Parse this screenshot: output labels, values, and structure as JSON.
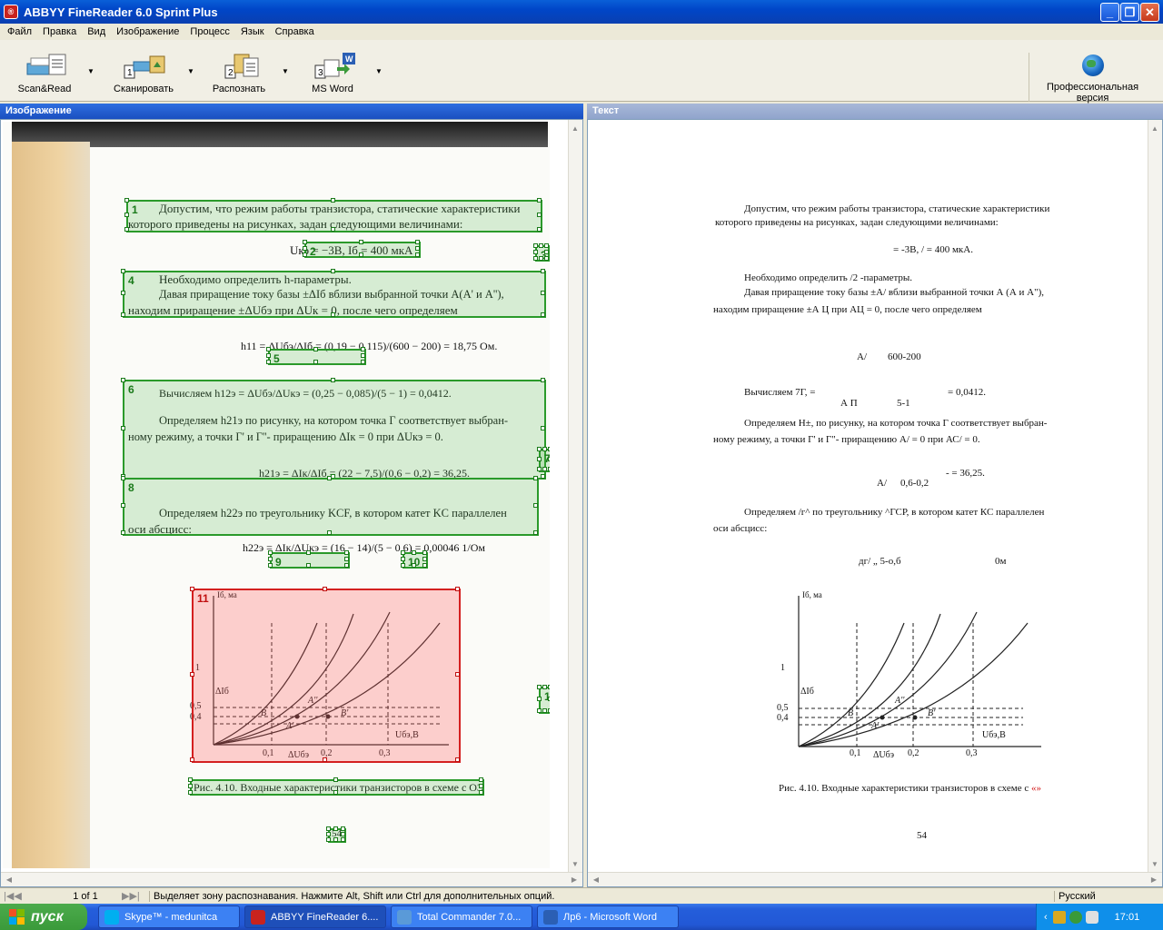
{
  "window": {
    "title": "ABBYY FineReader 6.0 Sprint Plus"
  },
  "menu": [
    "Файл",
    "Правка",
    "Вид",
    "Изображение",
    "Процесс",
    "Язык",
    "Справка"
  ],
  "toolbar": {
    "buttons": [
      {
        "label": "Scan&Read",
        "icon": "scan-read-icon"
      },
      {
        "label": "Сканировать",
        "icon": "scan-icon",
        "step": "1"
      },
      {
        "label": "Распознать",
        "icon": "recognize-icon",
        "step": "2"
      },
      {
        "label": "MS Word",
        "icon": "word-export-icon",
        "step": "3"
      }
    ],
    "pro_label": "Профессиональная версия"
  },
  "panes": {
    "image_title": "Изображение",
    "text_title": "Текст"
  },
  "scan": {
    "p1a": "Допустим, что режим работы транзистора, статические характеристики",
    "p1b": "которого приведены на рисунках, задан следующими величинами:",
    "eq1": "Uкэ = −3В, Iб = 400 мкА .",
    "p2a": "Необходимо определить h-параметры.",
    "p2b": "Давая приращение току базы ±ΔIб вблизи выбранной точки A(A' и A''),",
    "p2c": "находим приращение ±ΔUбэ при ΔUк = 0, после чего определяем",
    "eq2a": "h11 = ΔUбэ/ΔIб = (0,19 − 0,115)/(600 − 200) = 18,75 Ом.",
    "p3a": "Вычисляем h12э = ΔUбэ/ΔUкэ = (0,25 − 0,085)/(5 − 1) = 0,0412.",
    "p3b": "Определяем h21э по рисунку, на котором точка Г соответствует выбран-",
    "p3c": "ному режиму, а точки Г' и Г''- приращению ΔIк = 0 при ΔUкэ = 0.",
    "eq3": "h21э = ΔIк/ΔIб = (22 − 7,5)/(0,6 − 0,2) = 36,25.",
    "p4a": "Определяем h22э по треугольнику KCF, в котором катет KC параллелен",
    "p4b": "оси абсцисс:",
    "eq4": "h22э = ΔIк/ΔUкэ = (16 − 14)/(5 − 0,6) = 0,00046 1/Ом",
    "caption": "Рис. 4.10. Входные характеристики транзисторов в схеме с ОЭ",
    "page_no": "54"
  },
  "zones": [
    "1",
    "2",
    "3",
    "4",
    "5",
    "6",
    "7",
    "8",
    "9",
    "10",
    "11",
    "12"
  ],
  "recognized": {
    "l1": "Допустим, что режим работы транзистора, статические характеристики",
    "l2": "которого приведены на рисунках, задан следующими величинами:",
    "l3": "= -3В, / = 400 мкА.",
    "l4": "Необходимо определить /2 -параметры.",
    "l5": "Давая приращение току базы ±А/ вблизи выбранной точки А (А и А\"),",
    "l6": "находим приращение ±А Ц при АЦ = 0, после чего определяем",
    "l7": "А/",
    "l7b": "600-200",
    "l8": "Вычисляем 7Г, =",
    "l8b": "= 0,0412.",
    "l8c": "А П",
    "l8d": "5-1",
    "l9": "Определяем Н±, по рисунку, на котором точка Г соответствует выбран-",
    "l10": "ному режиму, а точки Г' и Г\"- приращению А/ = 0 при АС/ = 0.",
    "l11": "А/",
    "l11b": "0,6-0,2",
    "l11c": "- = 36,25.",
    "l12": "Определяем /г^ по треугольнику ^ГСР, в котором катет КС параллелен",
    "l13": "оси абсцисс:",
    "l14": "дг/ „ 5-о,б",
    "l14b": "0м",
    "caption": "Рис. 4.10. Входные характеристики транзисторов в схеме с",
    "caption_mark": "«»",
    "page_no": "54"
  },
  "graph": {
    "ylabel": "Iб, ма",
    "xlabel": "Uбэ,В",
    "y_ticks": [
      "1",
      "0,5",
      "0,4"
    ],
    "x_ticks": [
      "0,1",
      "0,2",
      "0,3"
    ],
    "delta_i": "ΔIб",
    "delta_u": "ΔUбэ",
    "points": [
      "B",
      "A''",
      "A'",
      "B'"
    ]
  },
  "status": {
    "page": "1 of 1",
    "message": "Выделяет зону распознавания. Нажмите Alt, Shift или Ctrl для дополнительных опций.",
    "language": "Русский"
  },
  "taskbar": {
    "start": "пуск",
    "tasks": [
      {
        "label": "Skype™ - medunitca",
        "icon": "skype-icon",
        "color": "#00aff0"
      },
      {
        "label": "ABBYY FineReader 6....",
        "icon": "abbyy-icon",
        "color": "#c8231e"
      },
      {
        "label": "Total Commander 7.0...",
        "icon": "totalcmd-icon",
        "color": "#5a9ad8"
      },
      {
        "label": "Лр6 - Microsoft Word",
        "icon": "word-icon",
        "color": "#2b5fb4"
      }
    ],
    "lang": "RU",
    "time": "17:01"
  }
}
